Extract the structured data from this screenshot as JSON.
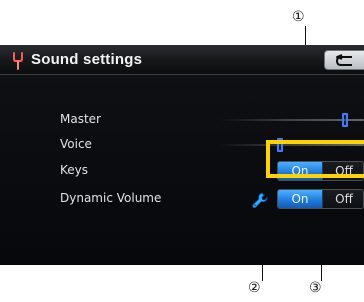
{
  "callouts": {
    "c1": "①",
    "c2": "②",
    "c3": "③"
  },
  "header": {
    "title": "Sound settings",
    "title_icon": "tuning-fork-icon",
    "back_icon": "return-arrow-icon"
  },
  "settings": {
    "master": {
      "label": "Master",
      "level": 0.92
    },
    "voice": {
      "label": "Voice",
      "level": 0.65
    },
    "keys": {
      "label": "Keys",
      "on_label": "On",
      "off_label": "Off",
      "selected": "On"
    },
    "dynamic_volume": {
      "label": "Dynamic Volume",
      "on_label": "On",
      "off_label": "Off",
      "selected": "On",
      "settings_icon": "wrench-icon"
    }
  },
  "colors": {
    "highlight": "#ffd300",
    "accent_blue": "#1e78d9",
    "slider_thumb_blue": "#3f7cff",
    "background": "#0b0d10"
  }
}
